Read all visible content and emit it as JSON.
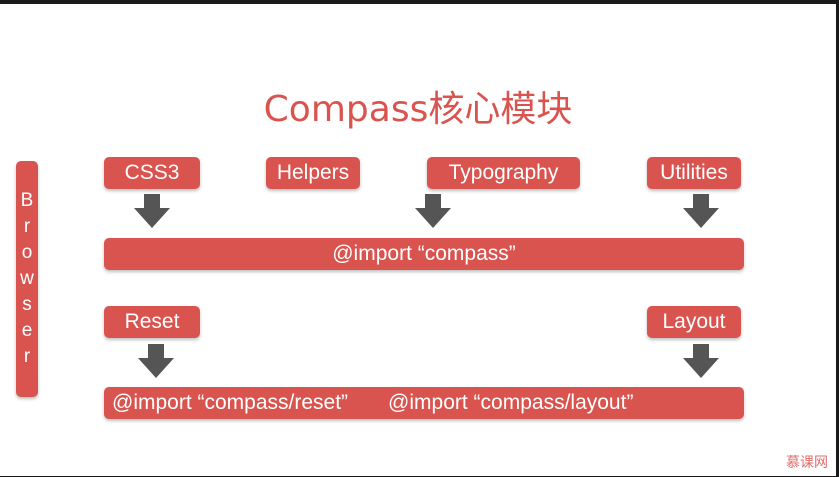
{
  "title": "Compass核心模块",
  "browser_letters": [
    "B",
    "r",
    "o",
    "w",
    "s",
    "e",
    "r"
  ],
  "modules_top": {
    "css3": "CSS3",
    "helpers": "Helpers",
    "typography": "Typography",
    "utilities": "Utilities"
  },
  "import_compass": "@import “compass”",
  "modules_bottom": {
    "reset": "Reset",
    "layout": "Layout"
  },
  "import_reset": "@import “compass/reset”",
  "import_layout": "@import “compass/layout”",
  "watermark": "慕课网",
  "colors": {
    "accent": "#d9534f",
    "arrow": "#555555"
  }
}
